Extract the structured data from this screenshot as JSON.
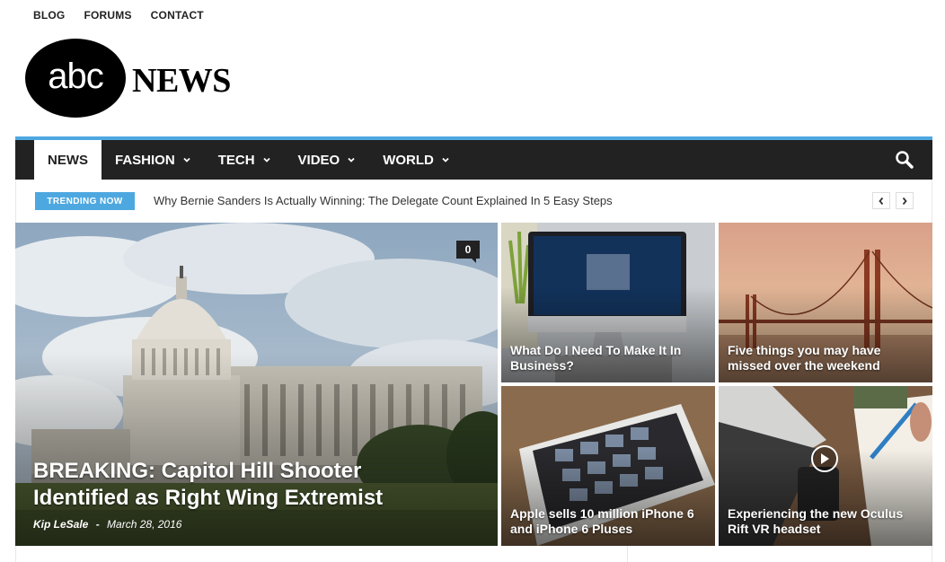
{
  "top_links": [
    "BLOG",
    "FORUMS",
    "CONTACT"
  ],
  "logo": {
    "oval_text": "abc",
    "word": "NEWS"
  },
  "nav": {
    "items": [
      {
        "label": "NEWS",
        "active": true,
        "has_dropdown": false
      },
      {
        "label": "FASHION",
        "active": false,
        "has_dropdown": true
      },
      {
        "label": "TECH",
        "active": false,
        "has_dropdown": true
      },
      {
        "label": "VIDEO",
        "active": false,
        "has_dropdown": true
      },
      {
        "label": "WORLD",
        "active": false,
        "has_dropdown": true
      }
    ],
    "search_icon": "search-icon"
  },
  "trending": {
    "badge": "TRENDING NOW",
    "headline": "Why Bernie Sanders Is Actually Winning: The Delegate Count Explained In 5 Easy Steps"
  },
  "featured": {
    "title": "BREAKING: Capitol Hill Shooter Identified as Right Wing Extremist",
    "author": "Kip LeSale",
    "separator": "-",
    "date": "March 28, 2016",
    "comments": "0"
  },
  "cards": [
    {
      "title": "What Do I Need To Make It In Business?"
    },
    {
      "title": "Five things you may have missed over the weekend"
    },
    {
      "title": "Apple sells 10 million iPhone 6 and iPhone 6 Pluses"
    },
    {
      "title": "Experiencing the new Oculus Rift VR headset"
    }
  ],
  "colors": {
    "accent": "#4ea8e0",
    "nav_bg": "#222222"
  }
}
